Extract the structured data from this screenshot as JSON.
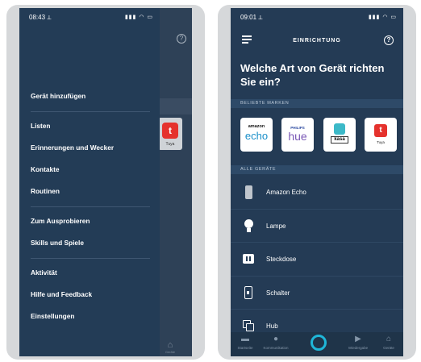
{
  "left": {
    "status": {
      "time": "08:43 ⟂",
      "icons": "▮▮▮ ◠ ▭"
    },
    "menu": {
      "group1": [
        "Gerät hinzufügen"
      ],
      "group2": [
        "Listen",
        "Erinnerungen und Wecker",
        "Kontakte",
        "Routinen"
      ],
      "group3": [
        "Zum Ausprobieren",
        "Skills und Spiele"
      ],
      "group4": [
        "Aktivität",
        "Hilfe und Feedback",
        "Einstellungen"
      ]
    },
    "behind": {
      "help_icon": "?",
      "tuya_logo": "t",
      "tuya_name": "Tuya",
      "tab_label": "Geräte"
    }
  },
  "right": {
    "status": {
      "time": "09:01 ⟂",
      "icons": "▮▮▮ ◠ ▭"
    },
    "header": {
      "title": "EINRICHTUNG",
      "help_icon": "?"
    },
    "question": "Welche Art von Gerät richten Sie ein?",
    "brands_section": "BELIEBTE MARKEN",
    "brands": {
      "echo": {
        "top": "amazon",
        "main": "echo"
      },
      "hue": {
        "top": "PHILIPS",
        "main": "hue"
      },
      "kasa": {
        "main": "kasa"
      },
      "tuya": {
        "logo": "t",
        "name": "Tuya"
      }
    },
    "devices_section": "ALLE GERÄTE",
    "devices": [
      "Amazon Echo",
      "Lampe",
      "Steckdose",
      "Schalter",
      "Hub"
    ],
    "tabs": [
      {
        "icon": "▬",
        "label": "Startseite"
      },
      {
        "icon": "●",
        "label": "Kommunikation"
      },
      {
        "icon": "",
        "label": ""
      },
      {
        "icon": "▶",
        "label": "Wiedergabe"
      },
      {
        "icon": "⌂",
        "label": "Geräte"
      }
    ]
  },
  "colors": {
    "background": "#243b55",
    "accent": "#1fb6d8",
    "tuya": "#e5322d"
  }
}
